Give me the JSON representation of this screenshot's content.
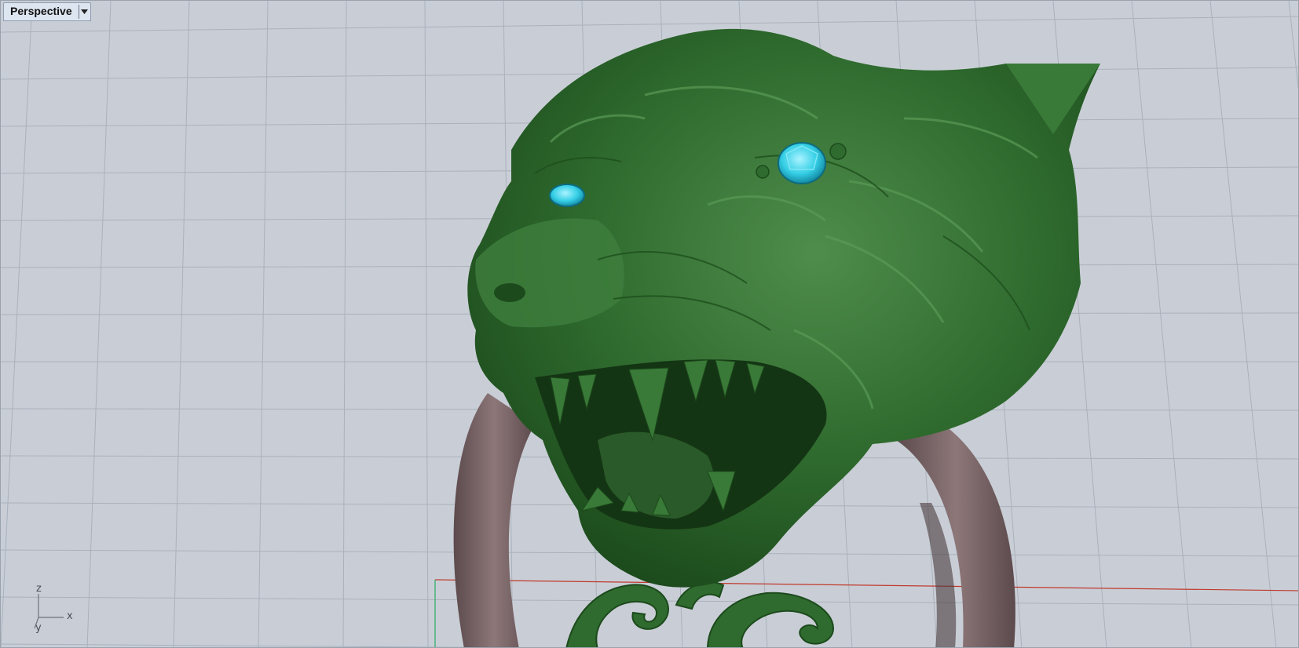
{
  "viewport": {
    "name": "Perspective",
    "dropdown_icon": "chevron-down-icon"
  },
  "axes": {
    "x": "x",
    "y": "y",
    "z": "z"
  },
  "model": {
    "description_icon": "wolf-head-ring-model",
    "head_color": "#2f6b2e",
    "eye_color": "#2fd0e8",
    "band_color": "#7a6465"
  },
  "colors": {
    "background": "#c9ced6",
    "grid": "#a9b0ba",
    "x_axis": "#c0392b",
    "y_axis": "#27ae60"
  }
}
